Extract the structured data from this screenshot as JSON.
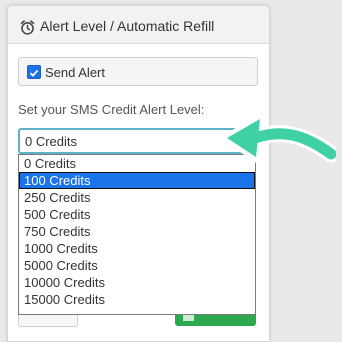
{
  "dialog": {
    "title": "Alert Level / Automatic Refill",
    "send_alert_label": "Send Alert",
    "send_alert_checked": true,
    "alert_level_label": "Set your SMS Credit Alert Level:",
    "select_value": "0 Credits",
    "options": [
      "0 Credits",
      "100 Credits",
      "250 Credits",
      "500 Credits",
      "750 Credits",
      "1000 Credits",
      "5000 Credits",
      "10000 Credits",
      "15000 Credits"
    ],
    "highlighted_option": "100 Credits"
  },
  "colors": {
    "accent_blue": "#1a73e8",
    "select_border": "#5fb0c9",
    "save_green": "#2ea84f",
    "arrow_teal": "#3fd1a5"
  },
  "icons": {
    "header": "alarm-clock-icon",
    "save": "floppy-disk-icon"
  }
}
